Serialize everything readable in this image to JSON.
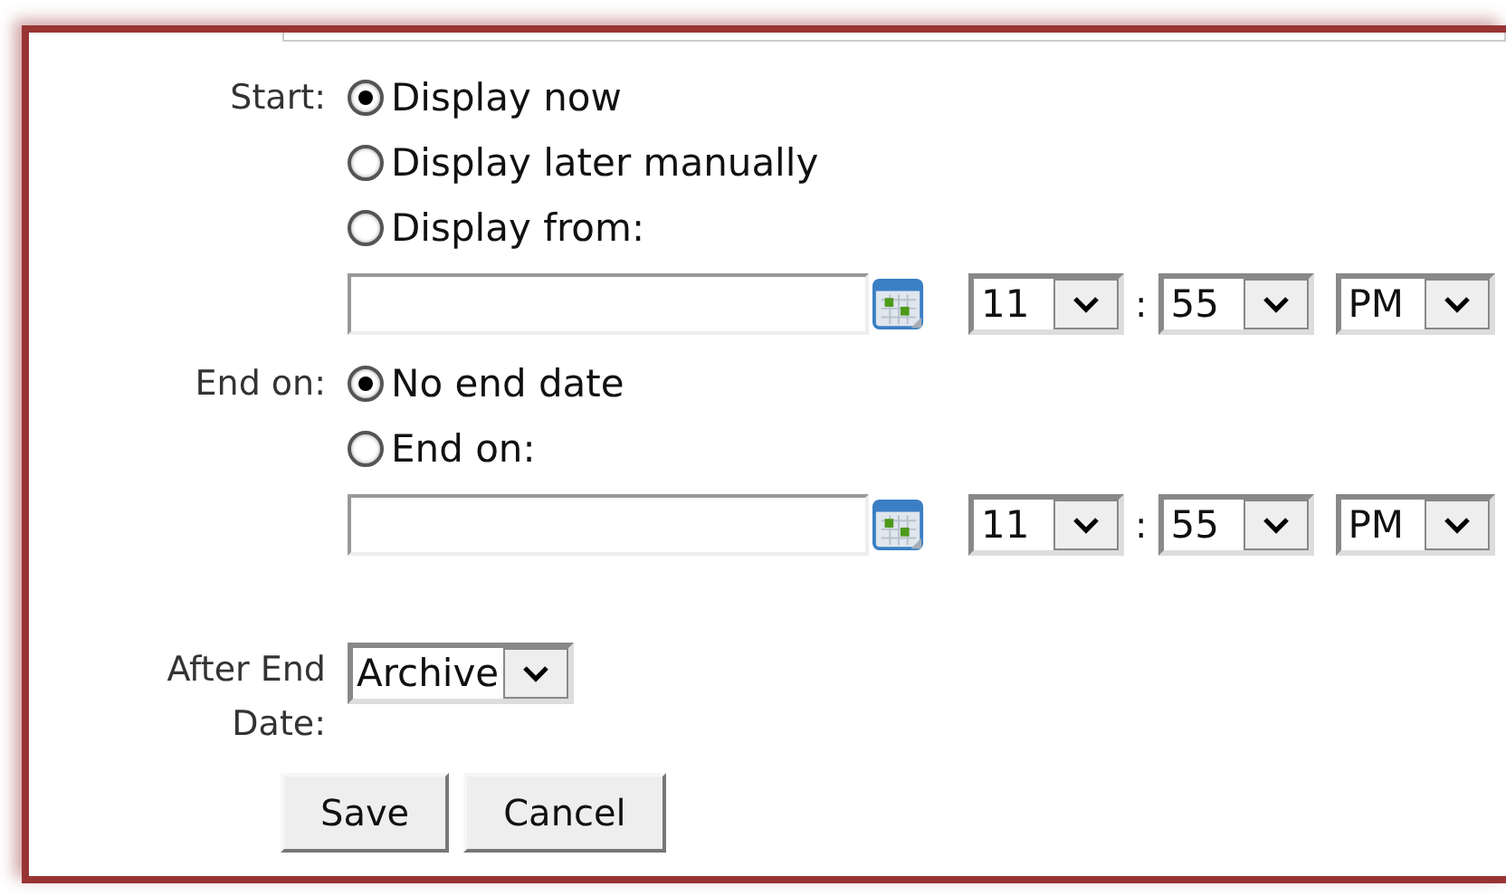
{
  "start": {
    "label": "Start:",
    "options": [
      {
        "label": "Display now",
        "selected": true
      },
      {
        "label": "Display later manually",
        "selected": false
      },
      {
        "label": "Display from:",
        "selected": false
      }
    ],
    "time": {
      "hour": "11",
      "separator": ":",
      "minute": "55",
      "ampm": "PM"
    }
  },
  "end": {
    "label": "End on:",
    "options": [
      {
        "label": "No end date",
        "selected": true
      },
      {
        "label": "End on:",
        "selected": false
      }
    ],
    "time": {
      "hour": "11",
      "separator": ":",
      "minute": "55",
      "ampm": "PM"
    }
  },
  "after_end": {
    "label": "After End Date:",
    "value": "Archive"
  },
  "buttons": [
    "Save",
    "Cancel"
  ]
}
